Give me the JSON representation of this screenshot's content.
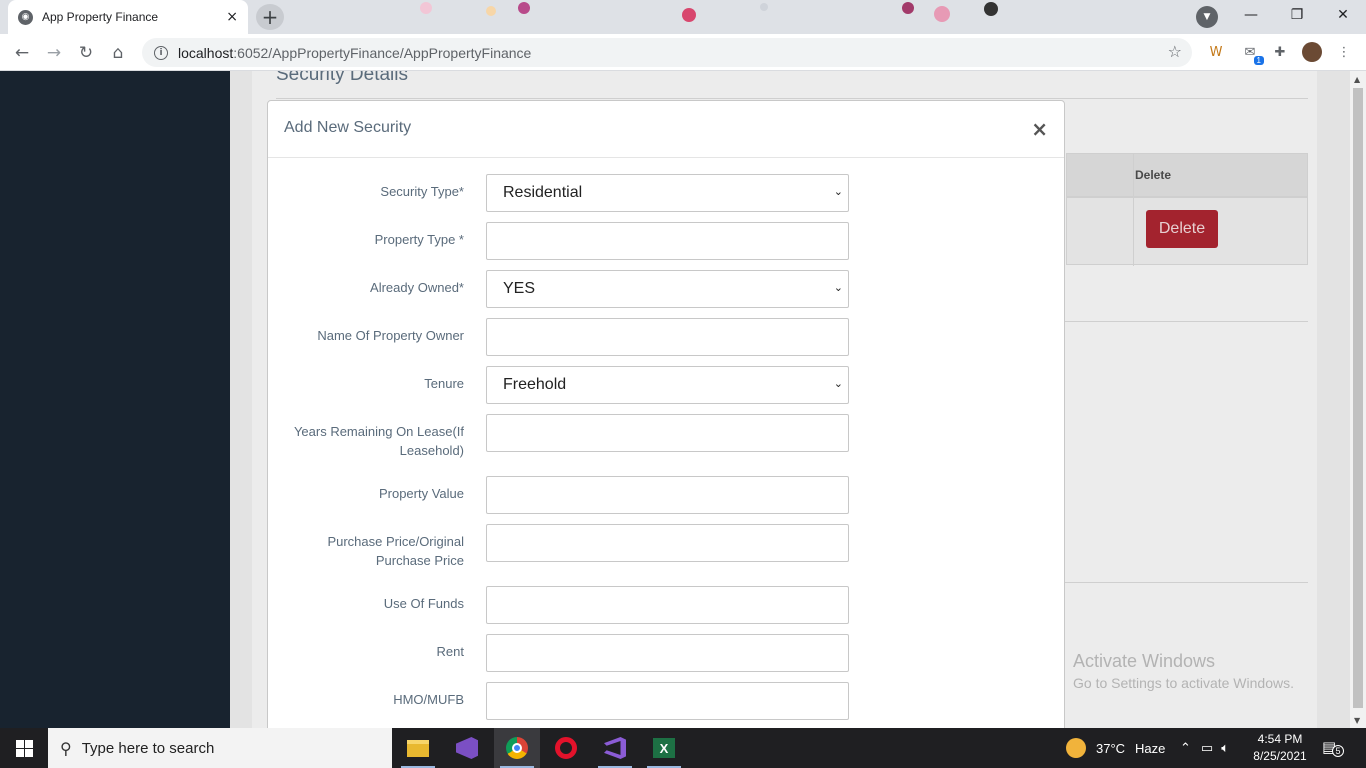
{
  "browser": {
    "tab_title": "App Property Finance",
    "tab_close": "×",
    "new_tab": "+",
    "url_host": "localhost",
    "url_rest": ":6052/AppPropertyFinance/AppPropertyFinance",
    "mail_badge": "1",
    "window_minimize": "—",
    "window_restore": "❐",
    "window_close": "✕"
  },
  "page": {
    "section_title": "Security Details",
    "table_header_delete": "Delete",
    "delete_button": "Delete",
    "watermark_line1": "Activate Windows",
    "watermark_line2": "Go to Settings to activate Windows."
  },
  "modal": {
    "title": "Add New Security",
    "close": "×",
    "fields": [
      {
        "label": "Security Type*",
        "type": "select",
        "value": "Residential"
      },
      {
        "label": "Property Type *",
        "type": "input",
        "value": ""
      },
      {
        "label": "Already Owned*",
        "type": "select",
        "value": "YES"
      },
      {
        "label": "Name Of Property Owner",
        "type": "input",
        "value": ""
      },
      {
        "label": "Tenure",
        "type": "select",
        "value": "Freehold"
      },
      {
        "label": "Years Remaining On Lease(If Leasehold)",
        "type": "input",
        "value": ""
      },
      {
        "label": "Property Value",
        "type": "input",
        "value": ""
      },
      {
        "label": "Purchase Price/Original Purchase Price",
        "type": "input",
        "value": ""
      },
      {
        "label": "Use Of Funds",
        "type": "input",
        "value": ""
      },
      {
        "label": "Rent",
        "type": "input",
        "value": ""
      },
      {
        "label": "HMO/MUFB",
        "type": "input",
        "value": ""
      }
    ]
  },
  "taskbar": {
    "search_placeholder": "Type here to search",
    "weather_temp": "37°C",
    "weather_text": "Haze",
    "time": "4:54 PM",
    "date": "8/25/2021",
    "notification_count": "5"
  },
  "colors": {
    "sidebar": "#18232f",
    "delete_button": "#a3232e",
    "modal_label": "#5a6b7b",
    "taskbar": "#1f1f22"
  }
}
